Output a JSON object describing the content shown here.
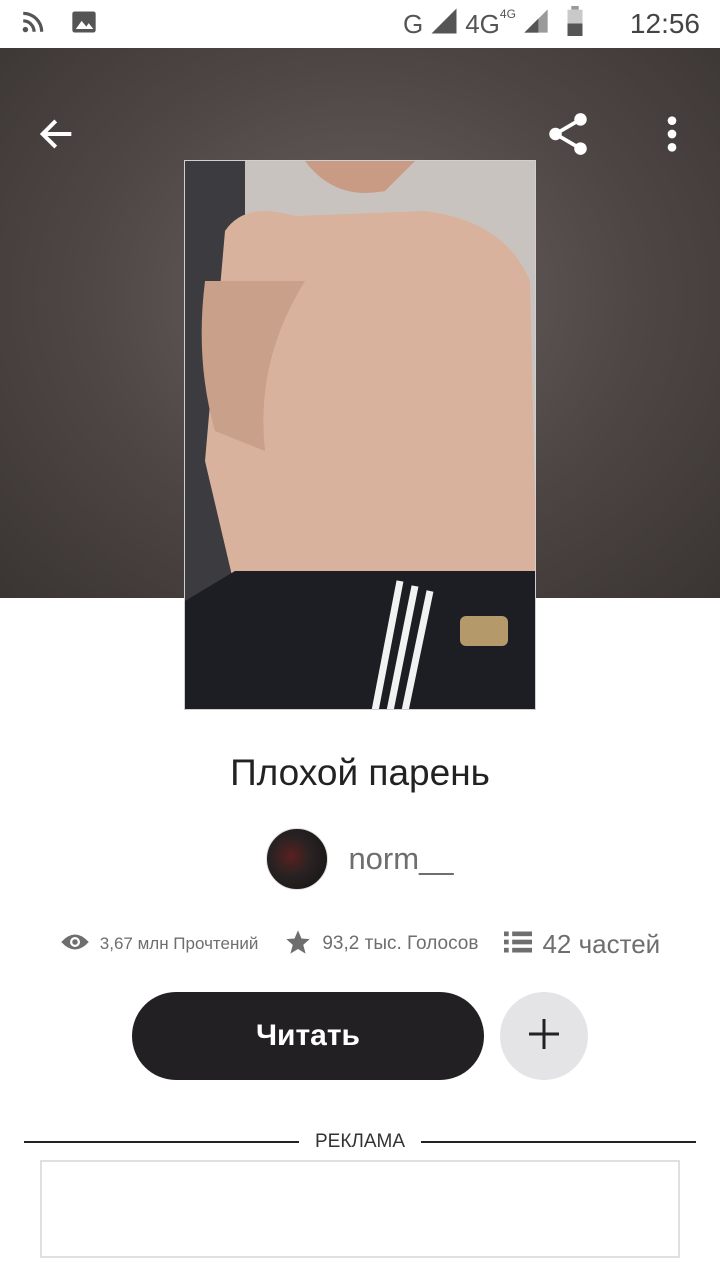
{
  "status_bar": {
    "network_g": "G",
    "network_4g": "4G",
    "network_4g_small": "4G",
    "time": "12:56"
  },
  "story": {
    "title": "Плохой парень",
    "author": "norm__"
  },
  "stats": {
    "reads": "3,67 млн Прочтений",
    "votes": "93,2 тыс. Голосов",
    "parts": "42 частей"
  },
  "actions": {
    "read_label": "Читать"
  },
  "ad": {
    "label": "РЕКЛАМА"
  },
  "colors": {
    "primary_button": "#222022",
    "secondary_button": "#e4e3e5",
    "hero_bg": "#4d4644"
  },
  "icons": [
    "rss-icon",
    "image-icon",
    "signal-icon",
    "battery-icon",
    "back-arrow-icon",
    "share-icon",
    "more-vertical-icon",
    "eye-icon",
    "star-icon",
    "list-icon",
    "plus-icon"
  ]
}
